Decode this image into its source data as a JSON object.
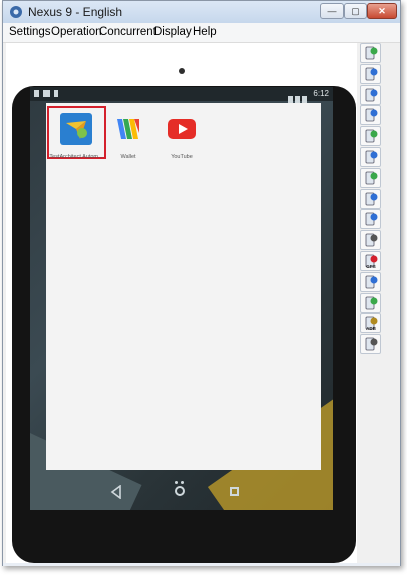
{
  "window": {
    "title": "Nexus 9 - English",
    "controls": {
      "minimize": "—",
      "maximize": "▢",
      "close": "✕"
    }
  },
  "menu": {
    "items": [
      "Settings",
      "Operation",
      "Concurrent",
      "Display",
      "Help"
    ]
  },
  "device": {
    "status_time": "6:12",
    "apps": [
      {
        "label": "TestArchitect Autom...",
        "icon": "testarchitect-icon",
        "selected": true
      },
      {
        "label": "Wallet",
        "icon": "wallet-icon",
        "selected": false
      },
      {
        "label": "YouTube",
        "icon": "youtube-icon",
        "selected": false
      }
    ]
  },
  "toolbar": {
    "tools": [
      {
        "name": "settings-globe-tool-icon",
        "color": "#3aa84a"
      },
      {
        "name": "rotate-device-tool-icon",
        "color": "#2f6fd4"
      },
      {
        "name": "browser-tool-icon",
        "color": "#2f6fd4"
      },
      {
        "name": "screenshot-tool-icon",
        "color": "#2f6fd4"
      },
      {
        "name": "wifi-tool-icon",
        "color": "#3aa84a"
      },
      {
        "name": "install-tool-icon",
        "color": "#2f6fd4"
      },
      {
        "name": "file-transfer-tool-icon",
        "color": "#3aa84a"
      },
      {
        "name": "device-info-tool-icon",
        "color": "#2f6fd4"
      },
      {
        "name": "copy-tool-icon",
        "color": "#2f6fd4"
      },
      {
        "name": "record-tool-icon",
        "color": "#555555"
      },
      {
        "name": "gps-tool-icon",
        "color": "#d4202c",
        "label": "GPS"
      },
      {
        "name": "logcat-tool-icon",
        "color": "#2f6fd4"
      },
      {
        "name": "refresh-tool-icon",
        "color": "#3aa84a"
      },
      {
        "name": "adb-tool-icon",
        "color": "#b08a20",
        "label": "ADB"
      },
      {
        "name": "phone-transfer-tool-icon",
        "color": "#555555"
      }
    ]
  },
  "colors": {
    "highlight": "#d4202c",
    "home_background": "#f3f3f3",
    "bezel": "#141414"
  }
}
